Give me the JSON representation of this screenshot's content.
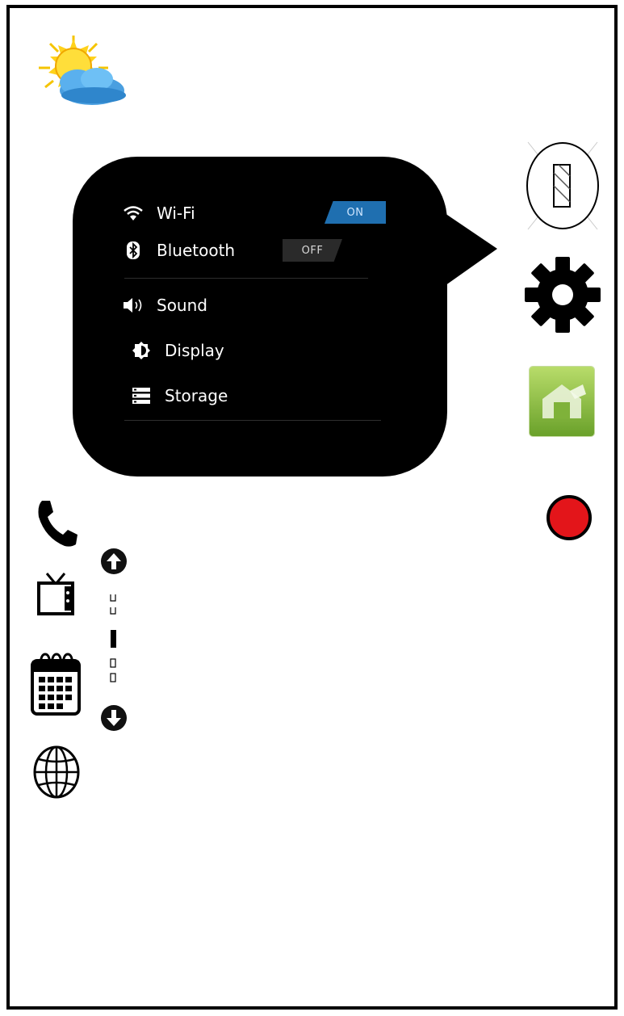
{
  "quick_settings": {
    "wifi": {
      "label": "Wi-Fi",
      "state": "ON"
    },
    "bluetooth": {
      "label": "Bluetooth",
      "state": "OFF"
    },
    "items": [
      {
        "label": "Sound",
        "icon": "speaker-icon"
      },
      {
        "label": "Display",
        "icon": "brightness-icon"
      },
      {
        "label": "Storage",
        "icon": "storage-icon"
      }
    ]
  },
  "colors": {
    "bubble": "#000000",
    "toggle_on": "#1f6fb0",
    "record": "#e3151a",
    "app_icon": "#8cc63f"
  },
  "icons": {
    "weather": "sun-cloud-icon",
    "flash": "flashlight-icon",
    "settings": "gear-icon",
    "app": "android-app-icon",
    "record": "record-icon",
    "phone": "phone-icon",
    "tv": "tv-icon",
    "calendar": "calendar-icon",
    "browser": "globe-icon",
    "scroll_up": "arrow-up-icon",
    "scroll_down": "arrow-down-icon"
  }
}
